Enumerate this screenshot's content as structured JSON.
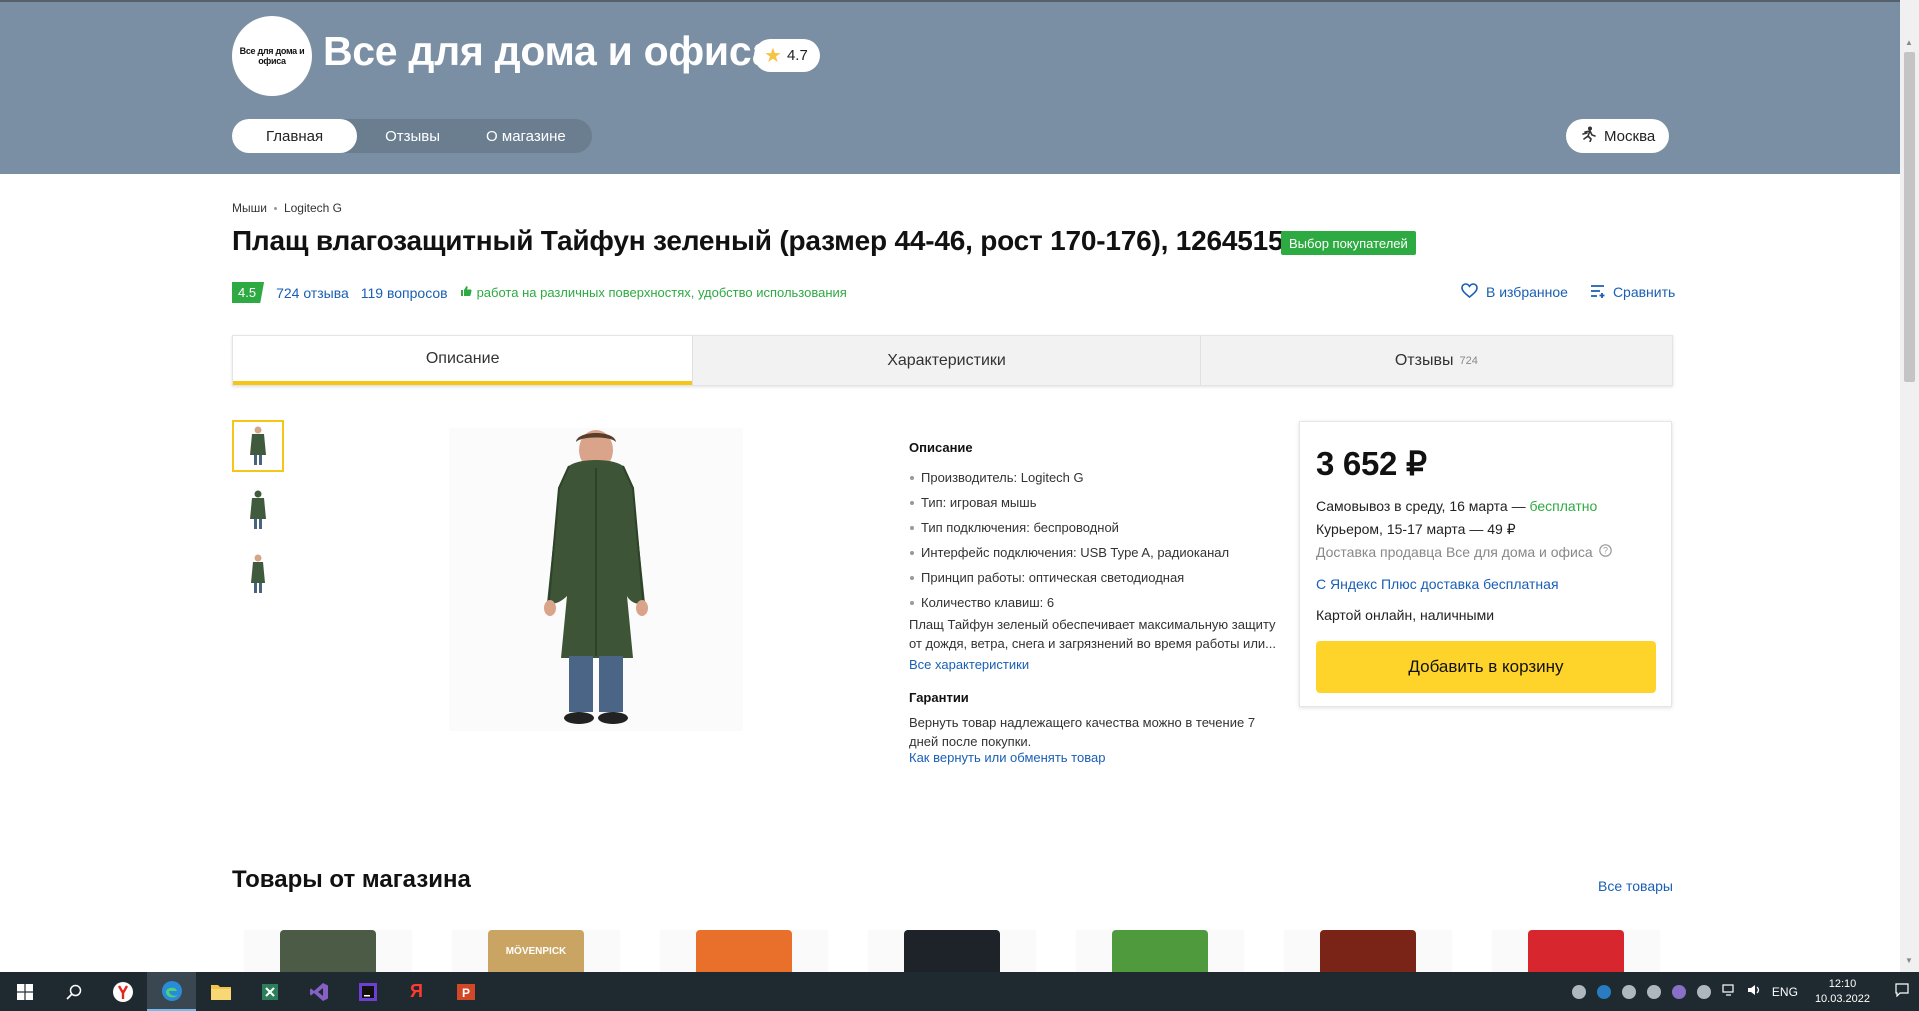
{
  "shop": {
    "logo_text": "Все для дома и офиса",
    "name": "Все для дома и офиса",
    "rating": "4.7",
    "nav": [
      {
        "label": "Главная"
      },
      {
        "label": "Отзывы"
      },
      {
        "label": "О магазине"
      }
    ],
    "city": "Москва"
  },
  "breadcrumb": [
    "Мыши",
    "Logitech G"
  ],
  "product": {
    "title": "Плащ влагозащитный Тайфун зеленый (размер 44-46, рост 170-176), 1264515",
    "badge": "Выбор покупателей",
    "rating": "4.5",
    "reviews_link": "724 отзыва",
    "questions_link": "119 вопросов",
    "highlight": "работа на различных поверхностях, удобство использования",
    "favorite": "В избранное",
    "compare": "Сравнить"
  },
  "tabs": [
    {
      "label": "Описание",
      "count": ""
    },
    {
      "label": "Характеристики",
      "count": ""
    },
    {
      "label": "Отзывы",
      "count": "724"
    }
  ],
  "description": {
    "heading": "Описание",
    "specs": [
      "Производитель: Logitech G",
      "Тип: игровая мышь",
      "Тип подключения: беспроводной",
      "Интерфейс подключения: USB Type A, радиоканал",
      "Принцип работы: оптическая светодиодная",
      "Количество клавиш: 6"
    ],
    "text_line1": "Плащ Тайфун зеленый обеспечивает максимальную защиту",
    "text_line2": "от дождя, ветра, снега и загрязнений во время работы или...",
    "all_specs_link": "Все характеристики",
    "guarantee_heading": "Гарантии",
    "guarantee_line1": "Вернуть товар надлежащего качества можно в течение 7",
    "guarantee_line2": "дней после покупки.",
    "return_link": "Как вернуть или обменять товар"
  },
  "offer": {
    "price": "3 652 ₽",
    "pickup": "Самовывоз в среду, 16 марта —",
    "pickup_free": "бесплатно",
    "courier": "Курьером, 15-17 марта — 49 ₽",
    "seller_delivery": "Доставка продавца Все для дома и офиса",
    "plus_link": "С Яндекс Плюс доставка бесплатная",
    "payment": "Картой онлайн, наличными",
    "add_to_cart": "Добавить в корзину"
  },
  "shop_goods": {
    "title": "Товары от магазина",
    "all_link": "Все товары",
    "items": [
      {
        "label": "",
        "color": "#4b5b45"
      },
      {
        "label": "MÖVENPICK",
        "color": "#caa463"
      },
      {
        "label": "",
        "color": "#e9702b"
      },
      {
        "label": "",
        "color": "#1e2329"
      },
      {
        "label": "",
        "color": "#4f9a3c"
      },
      {
        "label": "",
        "color": "#7a2418"
      },
      {
        "label": "",
        "color": "#d8262e"
      }
    ]
  },
  "taskbar": {
    "lang": "ENG",
    "time": "12:10",
    "date": "10.03.2022"
  },
  "colors": {
    "header_bg": "#7a8fa3",
    "accent_yellow": "#fed42b",
    "green": "#2daa41",
    "link_blue": "#1a5fb4"
  }
}
